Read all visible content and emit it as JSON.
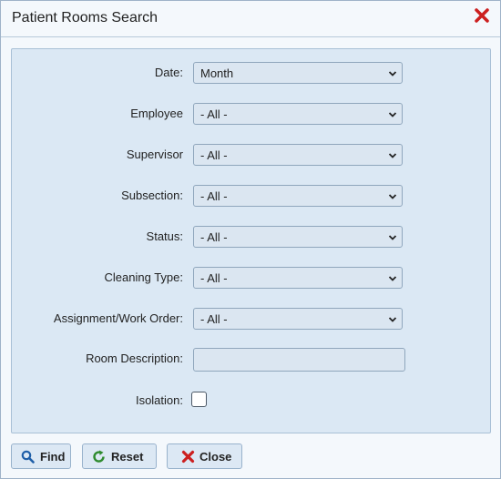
{
  "dialog": {
    "title": "Patient Rooms Search"
  },
  "form": {
    "date_label": "Date:",
    "date_value": "Month",
    "employee_label": "Employee",
    "employee_value": "- All -",
    "supervisor_label": "Supervisor",
    "supervisor_value": "- All -",
    "subsection_label": "Subsection:",
    "subsection_value": "- All -",
    "status_label": "Status:",
    "status_value": "- All -",
    "cleaning_type_label": "Cleaning Type:",
    "cleaning_type_value": "- All -",
    "assignment_label": "Assignment/Work Order:",
    "assignment_value": "- All -",
    "room_description_label": "Room Description:",
    "room_description_value": "",
    "isolation_label": "Isolation:",
    "isolation_checked": false
  },
  "buttons": {
    "find_label": "Find",
    "reset_label": "Reset",
    "close_label": "Close"
  },
  "icons": {
    "close": "close-icon",
    "find": "search-icon",
    "reset": "refresh-icon",
    "close_button": "x-icon",
    "chevron": "chevron-down-icon"
  },
  "colors": {
    "panel_bg": "#dbe8f4",
    "field_bg": "#dbe6f1",
    "close_red": "#cc1f1f",
    "find_blue": "#1f5fa8",
    "reset_green": "#2e8b2e"
  }
}
